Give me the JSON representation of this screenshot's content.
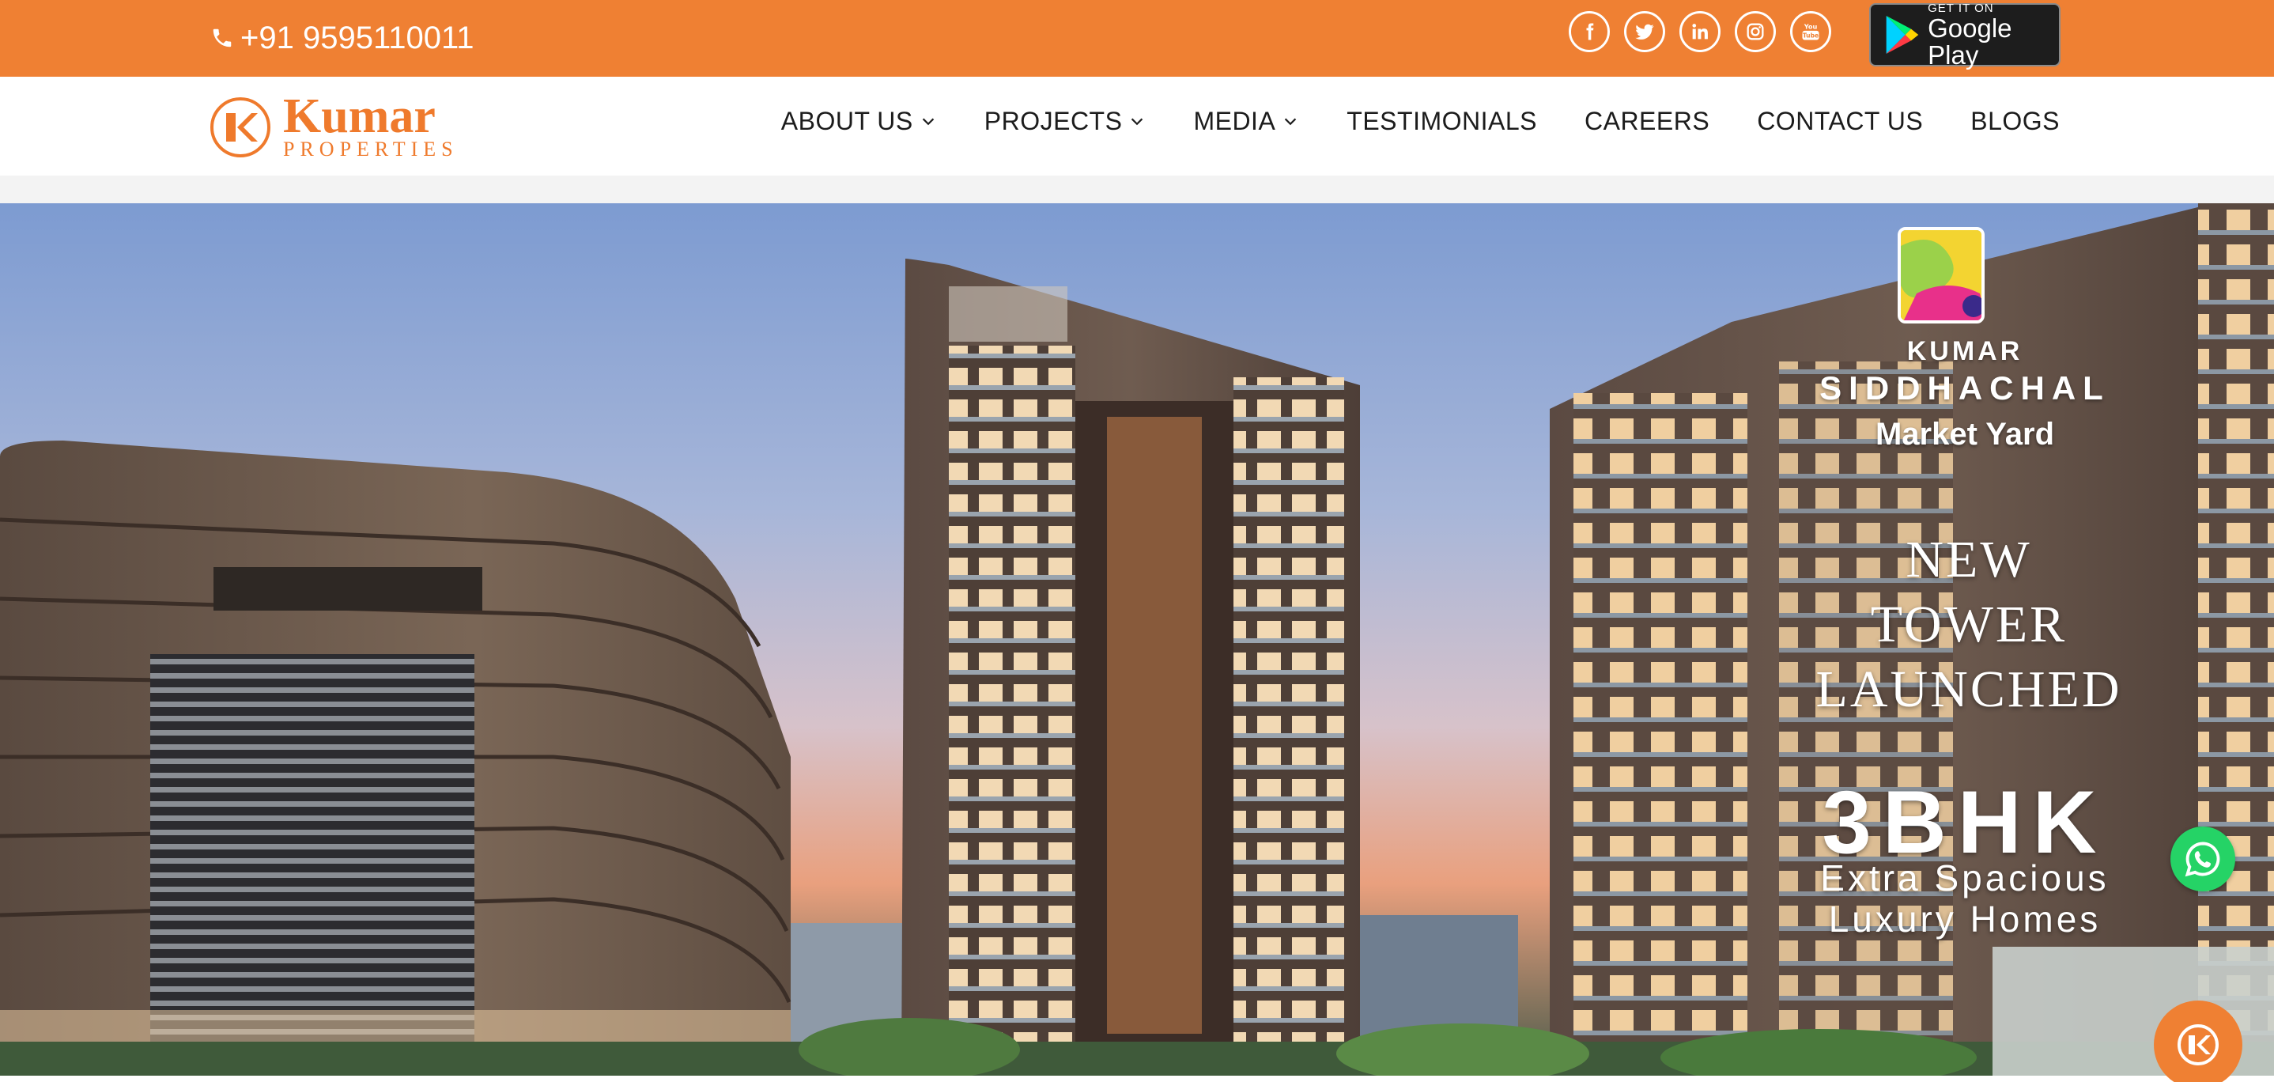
{
  "topbar": {
    "phone": "+91 9595110011",
    "socials": [
      "facebook-icon",
      "twitter-icon",
      "linkedin-icon",
      "instagram-icon",
      "youtube-icon"
    ],
    "google_play": {
      "small": "GET IT ON",
      "big": "Google Play"
    },
    "bg_color": "#ef8033"
  },
  "header": {
    "logo": {
      "brand": "Kumar",
      "sub": "PROPERTIES"
    },
    "nav": [
      {
        "label": "ABOUT US",
        "dropdown": true
      },
      {
        "label": "PROJECTS",
        "dropdown": true
      },
      {
        "label": "MEDIA",
        "dropdown": true
      },
      {
        "label": "TESTIMONIALS",
        "dropdown": false
      },
      {
        "label": "CAREERS",
        "dropdown": false
      },
      {
        "label": "CONTACT US",
        "dropdown": false
      },
      {
        "label": "BLOGS",
        "dropdown": false
      }
    ]
  },
  "hero": {
    "project_brand": "KUMAR",
    "project_name": "SIDDHACHAL",
    "location": "Market Yard",
    "launch_lines": [
      "NEW",
      "TOWER",
      "LAUNCHED"
    ],
    "config": "3BHK",
    "tagline_lines": [
      "Extra Spacious",
      "Luxury Homes"
    ]
  },
  "floating": {
    "whatsapp": "whatsapp-icon",
    "chatbot": "chatbot-icon"
  }
}
